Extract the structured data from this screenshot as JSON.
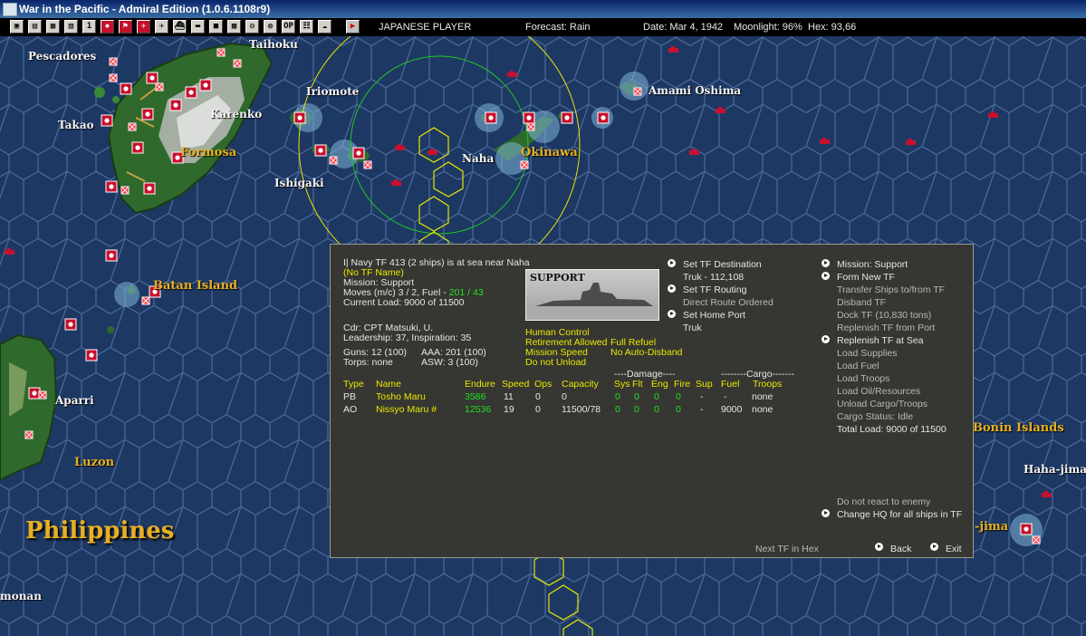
{
  "window": {
    "title": "War in the Pacific - Admiral Edition (1.0.6.1108r9)"
  },
  "status": {
    "player": "JAPANESE PLAYER",
    "forecast": "Forecast: Rain",
    "date": "Date: Mar 4, 1942",
    "moonlight": "Moonlight: 96%",
    "hex": "Hex: 93,66"
  },
  "toolbar": {
    "buttons": [
      "report-1",
      "report-2",
      "report-3",
      "report-4",
      "number-1",
      "japan-flag",
      "fleet",
      "aircraft",
      "air-group",
      "ship",
      "ground",
      "base",
      "map",
      "filter",
      "grid",
      "info",
      "clouds",
      "end-turn"
    ],
    "number_label": "1",
    "grid_label": "OP"
  },
  "map_labels": [
    {
      "text": "Pescadores",
      "kind": "city"
    },
    {
      "text": "Taihoku",
      "kind": "city"
    },
    {
      "text": "Iriomote",
      "kind": "city"
    },
    {
      "text": "Amami Oshima",
      "kind": "city"
    },
    {
      "text": "Takao",
      "kind": "city"
    },
    {
      "text": "Karenko",
      "kind": "city"
    },
    {
      "text": "Formosa",
      "kind": "region"
    },
    {
      "text": "Naha",
      "kind": "city"
    },
    {
      "text": "Okinawa",
      "kind": "region"
    },
    {
      "text": "Ishigaki",
      "kind": "city"
    },
    {
      "text": "Batan Island",
      "kind": "region"
    },
    {
      "text": "Aparri",
      "kind": "city"
    },
    {
      "text": "Luzon",
      "kind": "region"
    },
    {
      "text": "Philippines",
      "kind": "big"
    },
    {
      "text": "Bonin Islands",
      "kind": "region"
    },
    {
      "text": "Haha-jima",
      "kind": "city"
    },
    {
      "text": "-jima",
      "kind": "region"
    },
    {
      "text": "monan",
      "kind": "city"
    }
  ],
  "tf": {
    "header": "I| Navy TF 413 (2 ships) is at sea near Naha",
    "name": "(No TF Name)",
    "mission": "Mission: Support",
    "moves_prefix": "Moves (m/c) 3 / 2, Fuel - ",
    "fuel_value": "201 / 43",
    "current_load": "Current Load: 9000 of 11500",
    "commander": "Cdr: CPT  Matsuki, U.",
    "leadership": "Leadership: 37, Inspiration: 35",
    "guns": "Guns: 12 (100)",
    "aaa": "AAA: 201 (100)",
    "torps": "Torps: none",
    "asw": "ASW: 3 (100)",
    "image_caption": "SUPPORT",
    "options": [
      "Human Control",
      "Retirement Allowed",
      "Mission Speed",
      "Do not Unload",
      "Full Refuel",
      "No Auto-Disband"
    ]
  },
  "ship_table": {
    "group_damage": "----Damage----",
    "group_cargo": "--------Cargo-------",
    "headers": [
      "Type",
      "Name",
      "Endure",
      "Speed",
      "Ops",
      "Capacity",
      "Sys",
      "Flt",
      "Eng",
      "Fire",
      "Sup",
      "Fuel",
      "Troops"
    ],
    "rows": [
      [
        "PB",
        "Tosho Maru",
        "3586",
        "11",
        "0",
        "0",
        "0",
        "0",
        "0",
        "0",
        "-",
        "-",
        "none"
      ],
      [
        "AO",
        "Nissyo Maru #",
        "12536",
        "19",
        "0",
        "11500/78",
        "0",
        "0",
        "0",
        "0",
        "-",
        "9000",
        "none"
      ]
    ]
  },
  "routing": {
    "set_destination": "Set TF Destination",
    "destination": "Truk - 112,108",
    "set_routing": "Set TF Routing",
    "routing_mode": "Direct Route Ordered",
    "set_home": "Set Home Port",
    "home_port": "Truk"
  },
  "commands": {
    "mission": "Mission: Support",
    "form_new": "Form New TF",
    "transfer": "Transfer Ships to/from TF",
    "disband": "Disband TF",
    "dock": "Dock TF (10,830 tons)",
    "replenish_port": "Replenish TF from Port",
    "replenish_sea": "Replenish TF at Sea",
    "load_supplies": "Load Supplies",
    "load_fuel": "Load Fuel",
    "load_troops": "Load Troops",
    "load_oil": "Load Oil/Resources",
    "unload": "Unload Cargo/Troops",
    "cargo_status": "Cargo Status: Idle",
    "total_load": "Total Load: 9000 of 11500",
    "react": "Do not react to enemy",
    "change_hq": "Change HQ for all ships in TF"
  },
  "footer": {
    "next_tf": "Next TF in Hex",
    "back": "Back",
    "exit": "Exit"
  },
  "colors": {
    "ocean": "#1e3864",
    "hex_line": "#4a6a98",
    "land": "#2f6a2c",
    "panel": "#363633",
    "highlight_yellow": "#e8e800",
    "highlight_green": "#20e020",
    "range_yellow": "#e6e600",
    "range_green": "#1ec81e",
    "japan_red": "#c8102e"
  }
}
